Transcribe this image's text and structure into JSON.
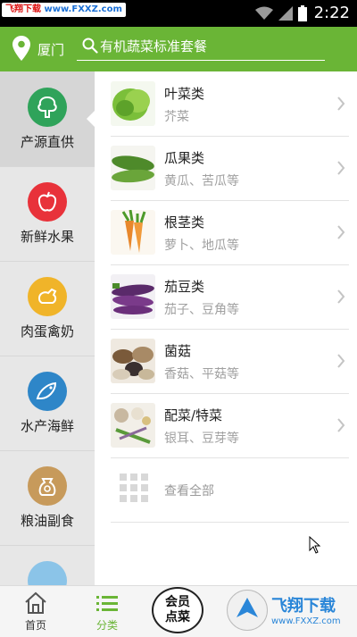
{
  "status_bar": {
    "watermark_prefix": "飞翔下载",
    "watermark_url": "www.FXXZ.com",
    "time": "2:22"
  },
  "header": {
    "city": "厦门",
    "search_placeholder": "有机蔬菜标准套餐"
  },
  "sidebar": {
    "items": [
      {
        "label": "产源直供",
        "icon": "tree-icon",
        "color": "#2fa35a",
        "active": true
      },
      {
        "label": "新鲜水果",
        "icon": "apple-icon",
        "color": "#e8323a",
        "active": false
      },
      {
        "label": "肉蛋禽奶",
        "icon": "chicken-icon",
        "color": "#f0b429",
        "active": false
      },
      {
        "label": "水产海鲜",
        "icon": "fish-icon",
        "color": "#2e86c8",
        "active": false
      },
      {
        "label": "粮油副食",
        "icon": "rice-bag-icon",
        "color": "#c79a5b",
        "active": false
      }
    ]
  },
  "categories": [
    {
      "title": "叶菜类",
      "subtitle": "芥菜",
      "icon": "leafy-greens-thumb"
    },
    {
      "title": "瓜果类",
      "subtitle": "黄瓜、苦瓜等",
      "icon": "melon-thumb"
    },
    {
      "title": "根茎类",
      "subtitle": "萝卜、地瓜等",
      "icon": "root-veg-thumb"
    },
    {
      "title": "茄豆类",
      "subtitle": "茄子、豆角等",
      "icon": "eggplant-thumb"
    },
    {
      "title": "菌菇",
      "subtitle": "香菇、平菇等",
      "icon": "mushroom-thumb"
    },
    {
      "title": "配菜/特菜",
      "subtitle": "银耳、豆芽等",
      "icon": "garnish-thumb"
    }
  ],
  "view_all": {
    "label": "查看全部"
  },
  "tabbar": {
    "tabs": [
      {
        "label": "首页",
        "icon": "home-icon",
        "active": false
      },
      {
        "label": "分类",
        "icon": "list-icon",
        "active": true
      }
    ],
    "member_line1": "会员",
    "member_line2": "点菜"
  },
  "watermark_bottom": {
    "name": "飞翔下载",
    "url": "www.FXXZ.com"
  },
  "colors": {
    "accent": "#6ab536",
    "sidebar_bg": "#e7e7e7",
    "sidebar_active": "#d6d6d6"
  }
}
